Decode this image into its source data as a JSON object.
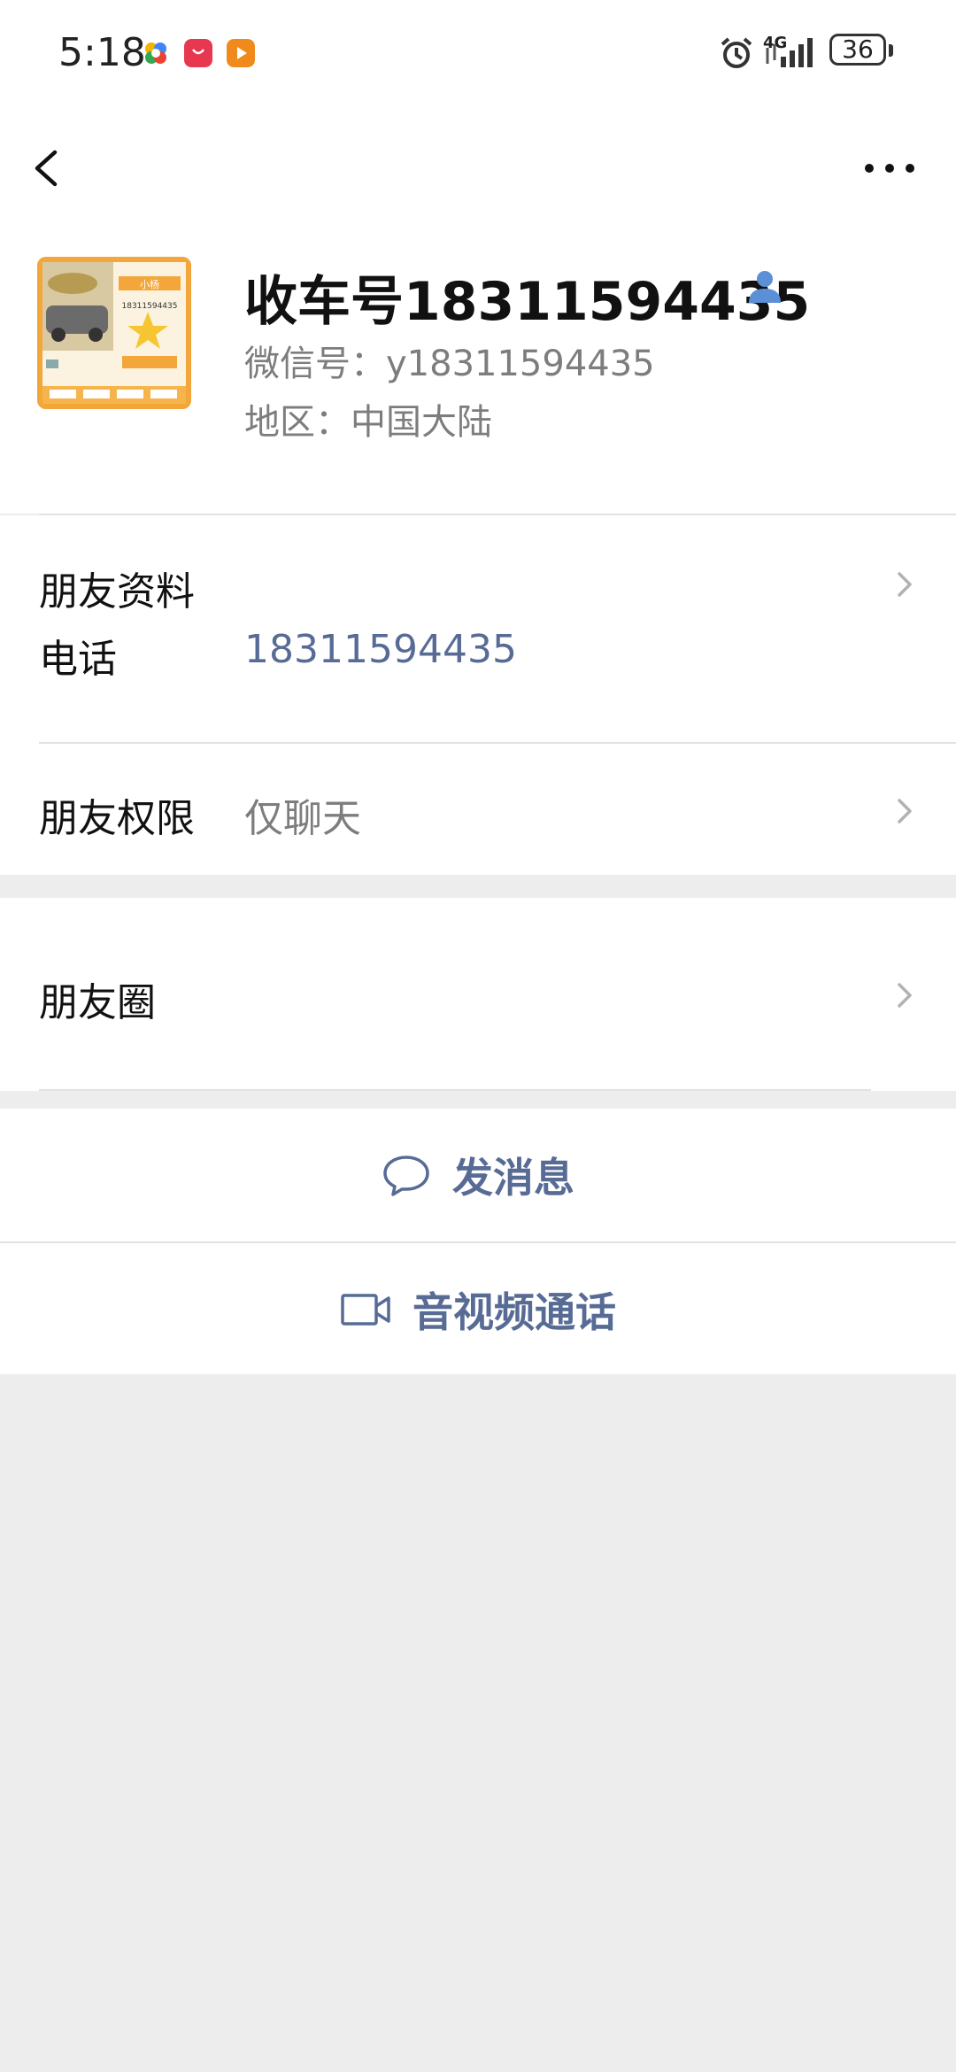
{
  "status_bar": {
    "time": "5:18",
    "network": "4G",
    "battery": "36",
    "icons": [
      "alarm-icon",
      "signal-icon",
      "battery-icon"
    ],
    "app_icons": [
      "photos-app-icon",
      "huawei-store-app-icon",
      "video-app-icon"
    ]
  },
  "nav": {
    "back_icon": "chevron-left-icon",
    "more_icon": "more-horizontal-icon"
  },
  "profile": {
    "nickname": "收车号18311594435",
    "wechat_id": "微信号：y18311594435",
    "region": "地区：中国大陆",
    "avatar": {
      "name": "小杨",
      "phone": "18311594435"
    },
    "badge_icon": "contact-person-icon"
  },
  "rows": {
    "friend_profile": "朋友资料",
    "phone_label": "电话",
    "phone_value": "18311594435",
    "permission_label": "朋友权限",
    "permission_value": "仅聊天",
    "moments": "朋友圈"
  },
  "actions": {
    "message": "发消息",
    "call": "音视频通话"
  },
  "colors": {
    "link": "#576b95",
    "background": "#ededed",
    "secondary_text": "#7d7d7d"
  }
}
